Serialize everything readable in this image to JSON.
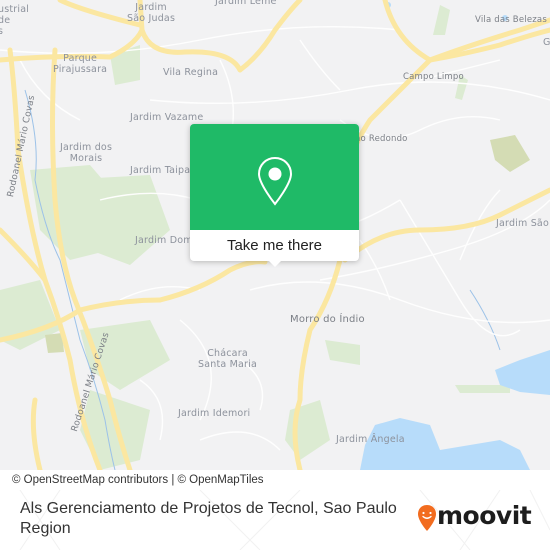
{
  "map": {
    "labels": [
      {
        "id": "jardim-sao-judas",
        "text": "Jardim\nSão Judas"
      },
      {
        "id": "jardim-leme",
        "text": "Jardim Leme"
      },
      {
        "id": "vila-das-belezas",
        "text": "Vila das Belezas"
      },
      {
        "id": "parque-pirajussara",
        "text": "Parque\nPirajussara"
      },
      {
        "id": "vila-regina",
        "text": "Vila Regina"
      },
      {
        "id": "campo-limpo",
        "text": "Campo Limpo"
      },
      {
        "id": "jardim-vazame",
        "text": "Jardim Vazame"
      },
      {
        "id": "capao-redondo",
        "text": "Capão Redondo"
      },
      {
        "id": "jardim-dos-morais",
        "text": "Jardim dos\nMorais"
      },
      {
        "id": "jardim-taipas",
        "text": "Jardim Taipas"
      },
      {
        "id": "jardim-dom-jose",
        "text": "Jardim Dom José"
      },
      {
        "id": "jardim-sao-luis",
        "text": "Jardim São Luís"
      },
      {
        "id": "morro-do-indio",
        "text": "Morro do Índio"
      },
      {
        "id": "chacara-santa-maria",
        "text": "Chácara\nSanta Maria"
      },
      {
        "id": "jardim-idemori",
        "text": "Jardim Idemori"
      },
      {
        "id": "jardim-angela",
        "text": "Jardim Ângela"
      },
      {
        "id": "rodoanel-top",
        "text": "Rodoanel Mário Covas"
      },
      {
        "id": "rodoanel-bottom",
        "text": "Rodoanel Mário Covas"
      },
      {
        "id": "industrial",
        "text": "ustrial\nde\ns"
      },
      {
        "id": "gi",
        "text": "Gi"
      }
    ],
    "attribution": "© OpenStreetMap contributors | © OpenMapTiles",
    "colors": {
      "land": "#f2f2f3",
      "road_major": "#fbe7a1",
      "park": "#d9ebcf",
      "water": "#b7dcfa",
      "accent": "#1fba67"
    }
  },
  "popup": {
    "icon": "map-pin-icon",
    "button_label": "Take me there"
  },
  "footer": {
    "title": "Als Gerenciamento de Projetos de Tecnol, Sao Paulo Region",
    "brand": "moovit",
    "brand_color": "#f26c1f"
  }
}
